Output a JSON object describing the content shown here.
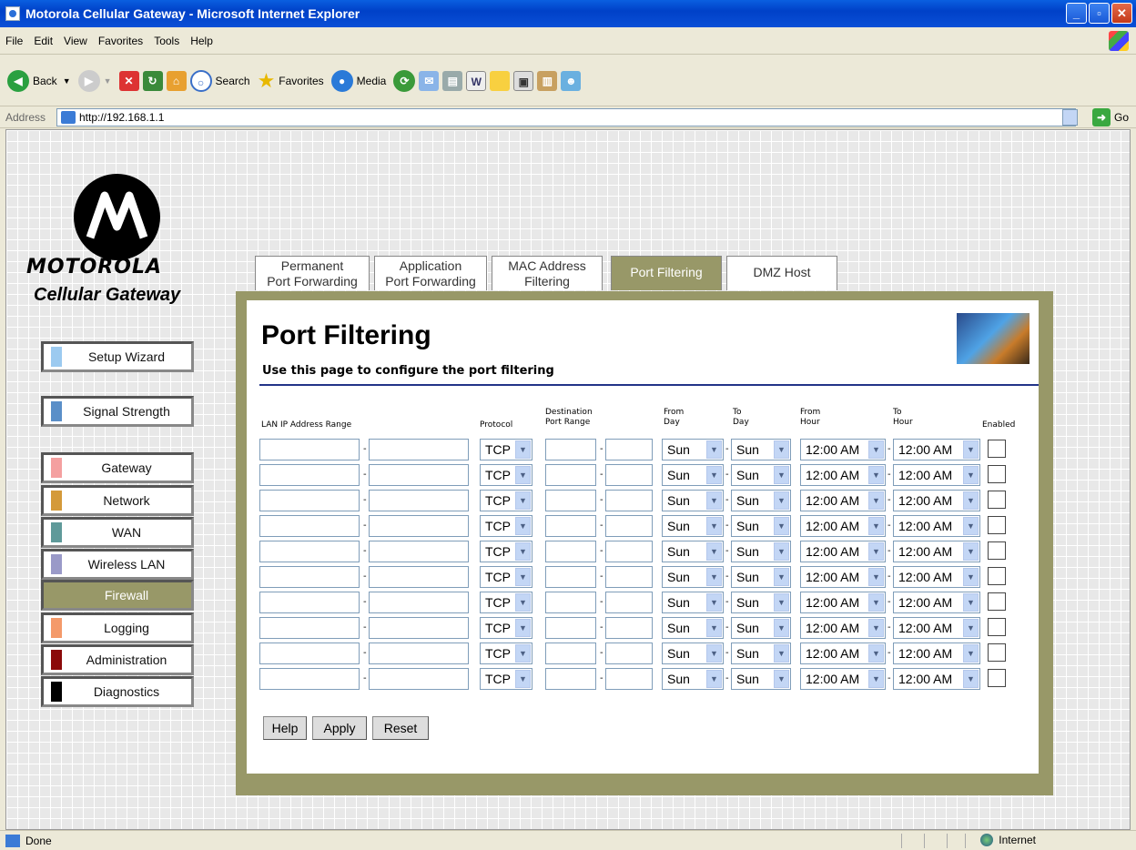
{
  "window": {
    "title": "Motorola Cellular Gateway - Microsoft Internet Explorer"
  },
  "menu": [
    "File",
    "Edit",
    "View",
    "Favorites",
    "Tools",
    "Help"
  ],
  "toolbar": {
    "back": "Back",
    "search": "Search",
    "favorites": "Favorites",
    "media": "Media"
  },
  "address": {
    "label": "Address",
    "url": "http://192.168.1.1",
    "go": "Go"
  },
  "brand": {
    "name": "MOTOROLA",
    "product": "Cellular Gateway"
  },
  "nav": {
    "setup": "Setup Wizard",
    "signal": "Signal Strength",
    "items": [
      {
        "label": "Gateway",
        "color": "#f4a0a0"
      },
      {
        "label": "Network",
        "color": "#d49a3a"
      },
      {
        "label": "WAN",
        "color": "#5f9a9a"
      },
      {
        "label": "Wireless LAN",
        "color": "#9a9ac8"
      },
      {
        "label": "Firewall",
        "color": "#989868"
      },
      {
        "label": "Logging",
        "color": "#f49a6a"
      },
      {
        "label": "Administration",
        "color": "#8b0a0a"
      },
      {
        "label": "Diagnostics",
        "color": "#000000"
      }
    ],
    "setup_color": "#9ccaf0",
    "signal_color": "#5a8fc8"
  },
  "tabs": {
    "t1a": "Permanent",
    "t1b": "Port Forwarding",
    "t2a": "Application",
    "t2b": "Port Forwarding",
    "t3a": "MAC Address",
    "t3b": "Filtering",
    "t4": "Port Filtering",
    "t5": "DMZ Host"
  },
  "page": {
    "title": "Port Filtering",
    "subtitle": "Use this page to configure the port filtering"
  },
  "headers": {
    "lan": "LAN IP Address Range",
    "protocol": "Protocol",
    "dest1": "Destination",
    "dest2": "Port Range",
    "fromday1": "From",
    "fromday2": "Day",
    "today1": "To",
    "today2": "Day",
    "fromhour1": "From",
    "fromhour2": "Hour",
    "tohour1": "To",
    "tohour2": "Hour",
    "enabled": "Enabled"
  },
  "row_defaults": {
    "protocol": "TCP",
    "from_day": "Sun",
    "to_day": "Sun",
    "from_hour": "12:00 AM",
    "to_hour": "12:00 AM"
  },
  "row_count": 10,
  "buttons": {
    "help": "Help",
    "apply": "Apply",
    "reset": "Reset"
  },
  "status": {
    "text": "Done",
    "zone": "Internet"
  }
}
